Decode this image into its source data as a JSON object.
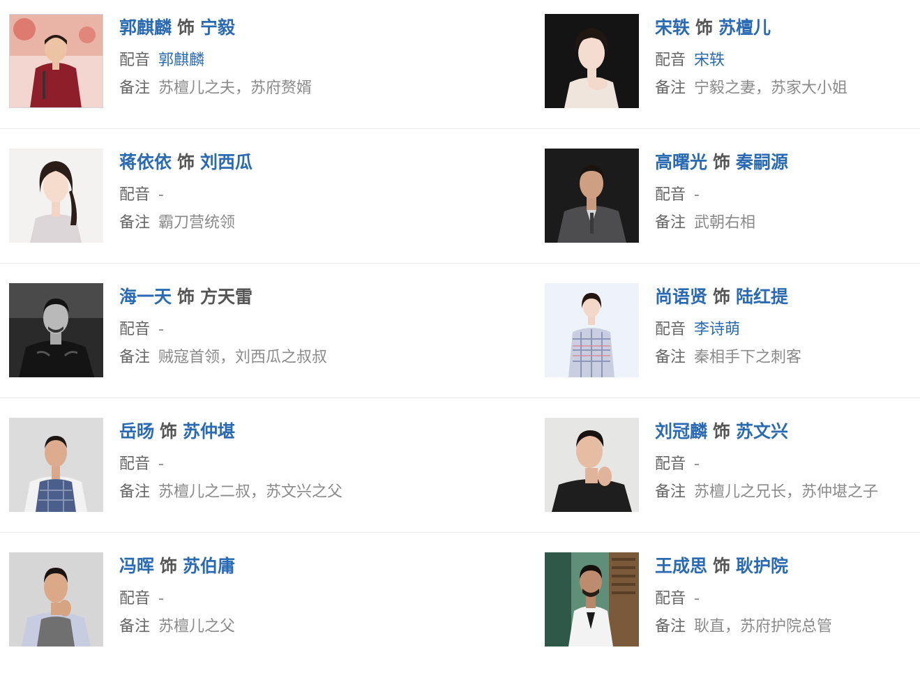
{
  "shi_label": "饰",
  "dub_label": "配音",
  "note_label": "备注",
  "cast": [
    {
      "actor": "郭麒麟",
      "role": "宁毅",
      "role_linked": true,
      "dub": "郭麒麟",
      "dub_linked": true,
      "note": "苏檀儿之夫，苏府赘婿",
      "photo": "portrait-red-gown"
    },
    {
      "actor": "宋轶",
      "role": "苏檀儿",
      "role_linked": true,
      "dub": "宋轶",
      "dub_linked": true,
      "note": "宁毅之妻，苏家大小姐",
      "photo": "portrait-dark-studio"
    },
    {
      "actor": "蒋依依",
      "role": "刘西瓜",
      "role_linked": true,
      "dub": "-",
      "dub_linked": false,
      "note": "霸刀营统领",
      "photo": "portrait-light-dress"
    },
    {
      "actor": "高曙光",
      "role": "秦嗣源",
      "role_linked": true,
      "dub": "-",
      "dub_linked": false,
      "note": "武朝右相",
      "photo": "portrait-dark-suit"
    },
    {
      "actor": "海一天",
      "role": "方天雷",
      "role_linked": false,
      "dub": "-",
      "dub_linked": false,
      "note": "贼寇首领，刘西瓜之叔叔",
      "photo": "portrait-bw-leather"
    },
    {
      "actor": "尚语贤",
      "role": "陆红提",
      "role_linked": true,
      "dub": "李诗萌",
      "dub_linked": true,
      "note": "秦相手下之刺客",
      "photo": "portrait-tweed-coat"
    },
    {
      "actor": "岳旸",
      "role": "苏仲堪",
      "role_linked": true,
      "dub": "-",
      "dub_linked": false,
      "note": "苏檀儿之二叔，苏文兴之父",
      "photo": "portrait-plaid-vest"
    },
    {
      "actor": "刘冠麟",
      "role": "苏文兴",
      "role_linked": true,
      "dub": "-",
      "dub_linked": false,
      "note": "苏檀儿之兄长，苏仲堪之子",
      "photo": "portrait-black-sweater"
    },
    {
      "actor": "冯晖",
      "role": "苏伯庸",
      "role_linked": true,
      "dub": "-",
      "dub_linked": false,
      "note": "苏檀儿之父",
      "photo": "portrait-grey-vest"
    },
    {
      "actor": "王成思",
      "role": "耿护院",
      "role_linked": true,
      "dub": "-",
      "dub_linked": false,
      "note": "耿直，苏府护院总管",
      "photo": "portrait-white-suit"
    }
  ]
}
